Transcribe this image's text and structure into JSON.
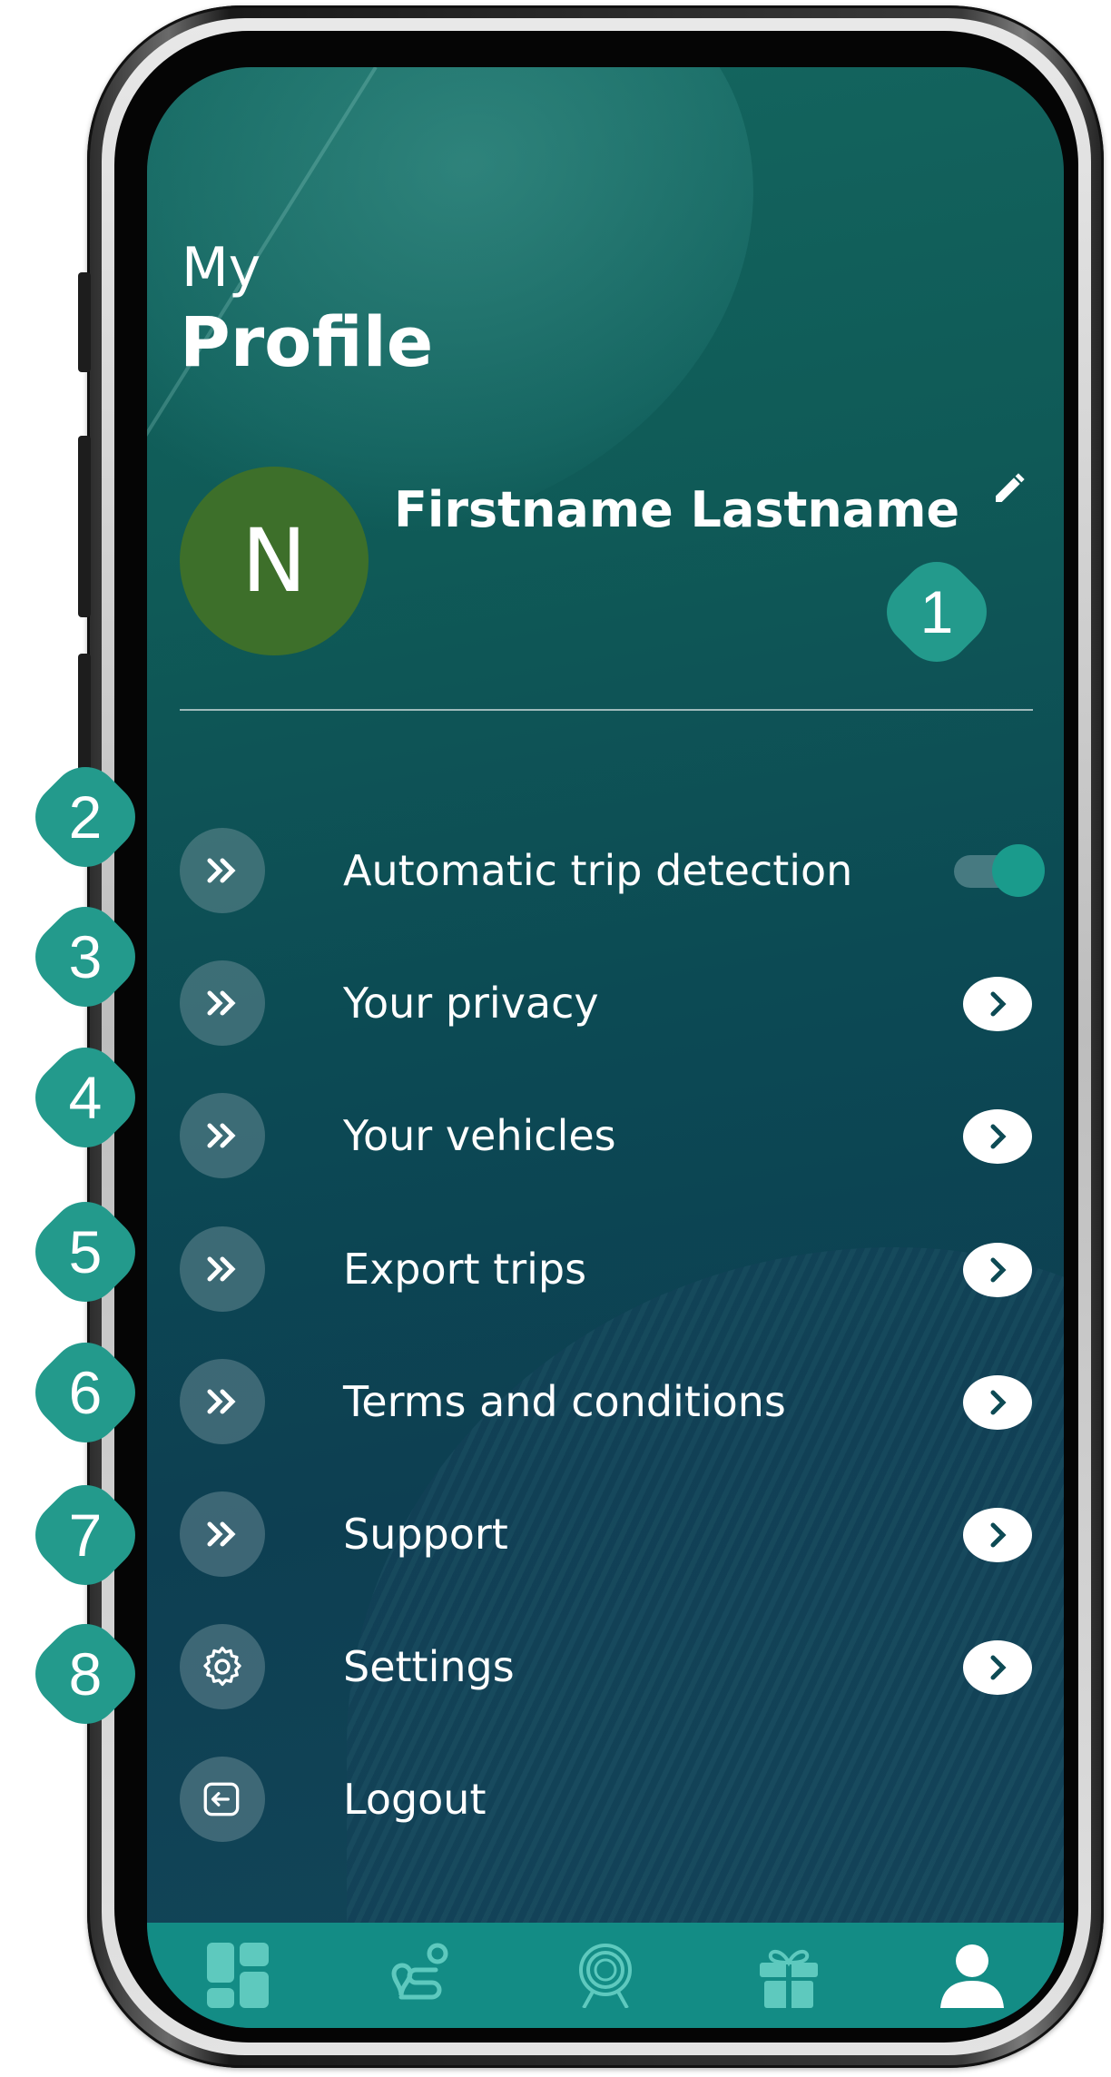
{
  "header": {
    "title_small": "My",
    "title_large": "Profile"
  },
  "profile": {
    "avatar_initial": "N",
    "name": "Firstname Lastname"
  },
  "menu": {
    "items": [
      {
        "label": "Automatic trip detection",
        "icon": "double-chevron-icon",
        "control": "toggle",
        "toggle_on": true
      },
      {
        "label": "Your privacy",
        "icon": "double-chevron-icon",
        "control": "chevron"
      },
      {
        "label": "Your vehicles",
        "icon": "double-chevron-icon",
        "control": "chevron"
      },
      {
        "label": "Export trips",
        "icon": "double-chevron-icon",
        "control": "chevron"
      },
      {
        "label": "Terms and conditions",
        "icon": "double-chevron-icon",
        "control": "chevron"
      },
      {
        "label": "Support",
        "icon": "double-chevron-icon",
        "control": "chevron"
      },
      {
        "label": "Settings",
        "icon": "gear-icon",
        "control": "chevron"
      },
      {
        "label": "Logout",
        "icon": "logout-icon",
        "control": "none"
      }
    ]
  },
  "bottom_nav": {
    "tabs": [
      "dashboard-icon",
      "route-icon",
      "badge-icon",
      "gift-icon",
      "user-icon"
    ],
    "active_tab": "user-icon"
  },
  "callouts": [
    "1",
    "2",
    "3",
    "4",
    "5",
    "6",
    "7",
    "8"
  ],
  "colors": {
    "screen_background": "#0d4a54",
    "accent": "#239a8c",
    "nav_background": "#138c85",
    "avatar_background": "#3d6f2a",
    "text": "#ffffff"
  }
}
